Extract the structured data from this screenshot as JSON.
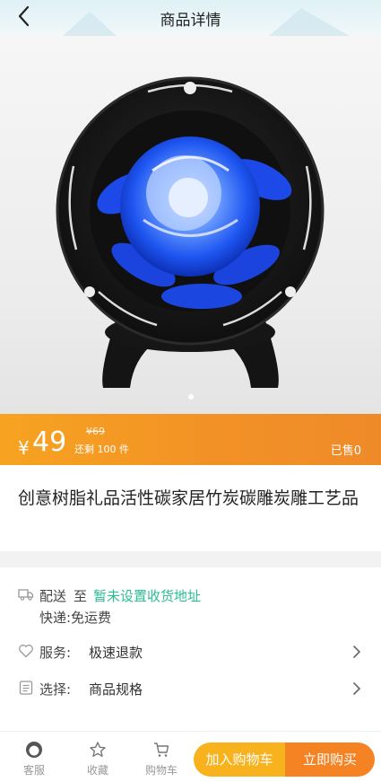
{
  "header": {
    "title": "商品详情"
  },
  "price": {
    "symbol": "¥",
    "current": "49",
    "original": "¥69",
    "stock": "还剩 100 件",
    "sold": "已售0"
  },
  "product": {
    "name": "创意树脂礼品活性碳家居竹炭碳雕炭雕工艺品"
  },
  "delivery": {
    "label": "配送",
    "to": "至",
    "address": "暂未设置收货地址",
    "express": "快递:免运费"
  },
  "service": {
    "label": "服务:",
    "value": "极速退款"
  },
  "spec": {
    "label": "选择:",
    "value": "商品规格"
  },
  "bottom_nav": {
    "service": "客服",
    "favorite": "收藏",
    "cart": "购物车",
    "add_to_cart": "加入购物车",
    "buy_now": "立即购买"
  },
  "colors": {
    "accent_orange": "#f29226",
    "accent_yellow": "#f8b21d",
    "green": "#2bbf93"
  }
}
